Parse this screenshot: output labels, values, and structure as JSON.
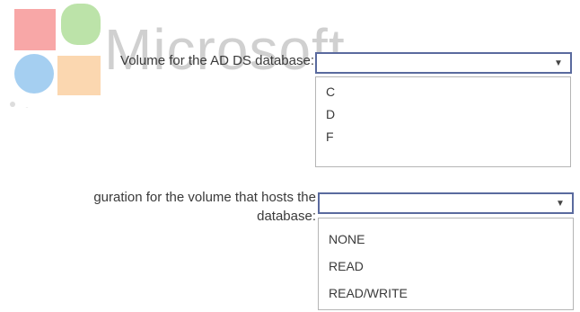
{
  "watermark": {
    "text": "Microsoft",
    "colors": {
      "red": "#f25c5c",
      "green": "#8ccf6c",
      "blue": "#5aa7e6",
      "orange": "#f7b56c"
    }
  },
  "question_1": {
    "label": "Volume for the AD DS database:",
    "selected": "",
    "options": [
      "C",
      "D",
      "F"
    ]
  },
  "question_2": {
    "label_line_1": "guration for the volume that hosts the",
    "label_line_2": "database:",
    "selected": "",
    "options": [
      "NONE",
      "READ",
      "READ/WRITE"
    ]
  }
}
